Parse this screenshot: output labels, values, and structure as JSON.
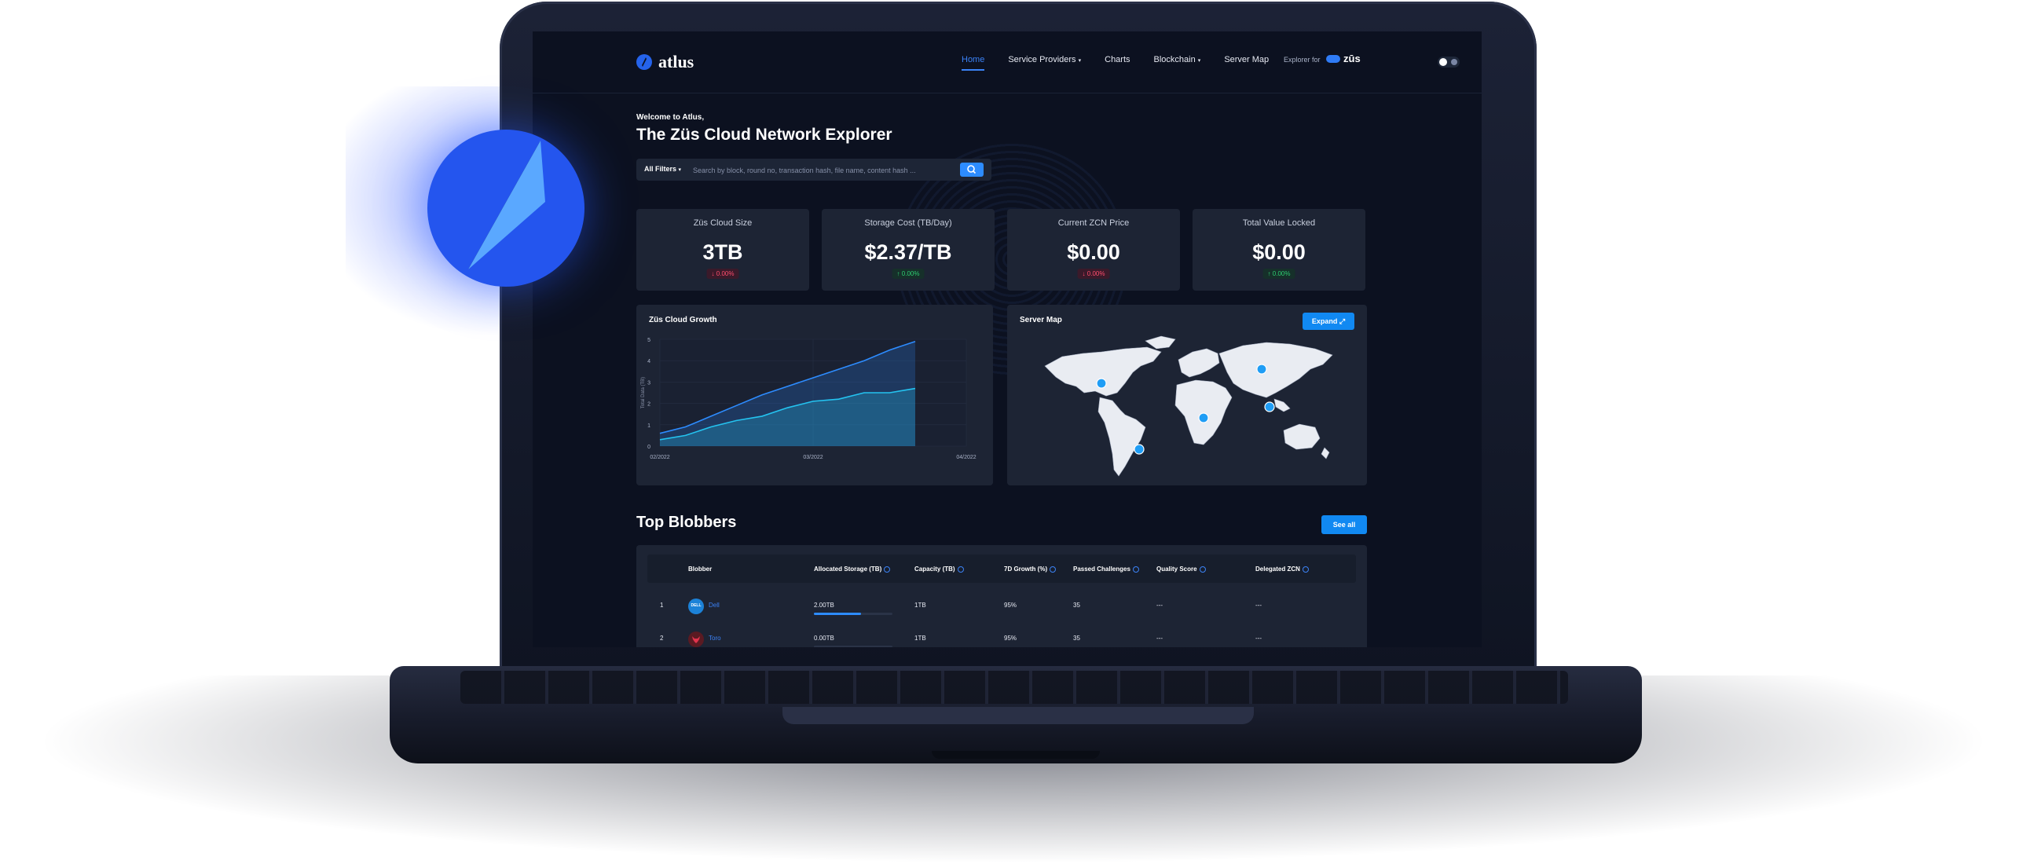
{
  "header": {
    "logo_text": "atlus",
    "nav": [
      {
        "label": "Home",
        "active": true,
        "dropdown": false
      },
      {
        "label": "Service Providers",
        "active": false,
        "dropdown": true
      },
      {
        "label": "Charts",
        "active": false,
        "dropdown": false
      },
      {
        "label": "Blockchain",
        "active": false,
        "dropdown": true
      },
      {
        "label": "Server Map",
        "active": false,
        "dropdown": false
      }
    ],
    "explorer_for": "Explorer for",
    "zus_logo": "zūs"
  },
  "hero": {
    "welcome": "Welcome to Atlus,",
    "title": "The Züs Cloud Network Explorer"
  },
  "search": {
    "filter_label": "All Filters",
    "placeholder": "Search by block, round no, transaction hash, file name, content hash ..."
  },
  "stats": [
    {
      "label": "Züs Cloud Size",
      "value": "3TB",
      "delta": "0.00%",
      "direction": "down"
    },
    {
      "label": "Storage Cost (TB/Day)",
      "value": "$2.37/TB",
      "delta": "0.00%",
      "direction": "up"
    },
    {
      "label": "Current ZCN Price",
      "value": "$0.00",
      "delta": "0.00%",
      "direction": "down"
    },
    {
      "label": "Total Value Locked",
      "value": "$0.00",
      "delta": "0.00%",
      "direction": "up"
    }
  ],
  "growth_panel": {
    "title": "Züs Cloud Growth"
  },
  "chart_data": {
    "type": "area",
    "title": "Züs Cloud Growth",
    "ylabel": "Total Data (TB)",
    "xlabel": "",
    "x_ticks": [
      "02/2022",
      "03/2022",
      "04/2022"
    ],
    "y_ticks": [
      0,
      1,
      2,
      3,
      4,
      5
    ],
    "ylim": [
      0,
      5
    ],
    "x": [
      0,
      1,
      2,
      3,
      4,
      5,
      6,
      7,
      8,
      9,
      10,
      11,
      12
    ],
    "series": [
      {
        "values": [
          0.6,
          0.9,
          1.4,
          1.9,
          2.4,
          2.8,
          3.2,
          3.6,
          4.0,
          4.5,
          4.9
        ]
      },
      {
        "values": [
          0.3,
          0.5,
          0.9,
          1.2,
          1.4,
          1.8,
          2.1,
          2.2,
          2.5,
          2.5,
          2.7
        ]
      }
    ],
    "grid": true,
    "colors": [
      "#2d8cff",
      "#24c3f0"
    ]
  },
  "map_panel": {
    "title": "Server Map",
    "expand_label": "Expand"
  },
  "blobbers": {
    "title": "Top Blobbers",
    "see_all": "See all",
    "columns": [
      "Blobber",
      "Allocated Storage (TB)",
      "Capacity (TB)",
      "7D Growth (%)",
      "Passed Challenges",
      "Quality Score",
      "Delegated ZCN"
    ],
    "rows": [
      {
        "rank": "1",
        "name": "Dell",
        "avatar_text": "DELL",
        "avatar_color": "#1c82d8",
        "allocated": "2.00TB",
        "allocated_fraction": 0.6,
        "capacity": "1TB",
        "growth": "95%",
        "passed": "35",
        "quality": "---",
        "delegated": "---"
      },
      {
        "rank": "2",
        "name": "Toro",
        "avatar_text": "",
        "avatar_color": "#5a1a22",
        "allocated": "0.00TB",
        "allocated_fraction": 0,
        "capacity": "1TB",
        "growth": "95%",
        "passed": "35",
        "quality": "---",
        "delegated": "---"
      }
    ]
  },
  "colors": {
    "accent": "#2d8cff",
    "panel": "#1d2434",
    "screen_bg": "#0c1120",
    "badge_blue": "#2455ee"
  }
}
